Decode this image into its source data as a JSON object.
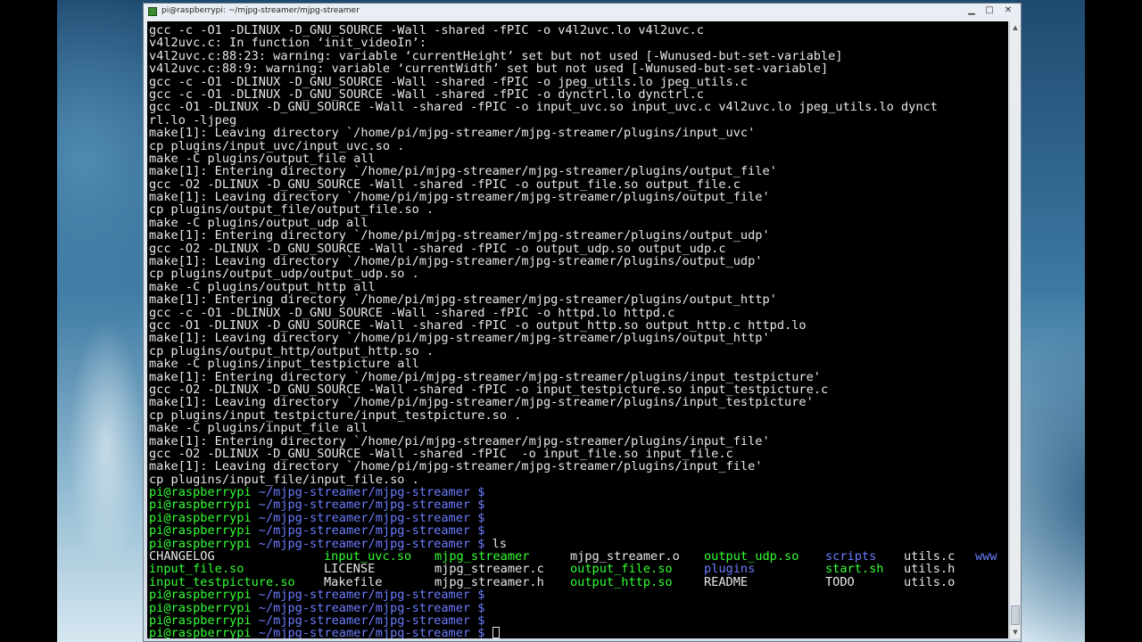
{
  "window": {
    "title": "pi@raspberrypi: ~/mjpg-streamer/mjpg-streamer",
    "buttons": {
      "minimize": "▁",
      "maximize": "□",
      "close": "✕"
    }
  },
  "terminal": {
    "output": [
      "gcc -c -O1 -DLINUX -D_GNU_SOURCE -Wall -shared -fPIC -o v4l2uvc.lo v4l2uvc.c",
      "v4l2uvc.c: In function ‘init_videoIn’:",
      "v4l2uvc.c:88:23: warning: variable ‘currentHeight’ set but not used [-Wunused-but-set-variable]",
      "v4l2uvc.c:88:9: warning: variable ‘currentWidth’ set but not used [-Wunused-but-set-variable]",
      "gcc -c -O1 -DLINUX -D_GNU_SOURCE -Wall -shared -fPIC -o jpeg_utils.lo jpeg_utils.c",
      "gcc -c -O1 -DLINUX -D_GNU_SOURCE -Wall -shared -fPIC -o dynctrl.lo dynctrl.c",
      "gcc -O1 -DLINUX -D_GNU_SOURCE -Wall -shared -fPIC -o input_uvc.so input_uvc.c v4l2uvc.lo jpeg_utils.lo dynct",
      "rl.lo -ljpeg",
      "make[1]: Leaving directory `/home/pi/mjpg-streamer/mjpg-streamer/plugins/input_uvc'",
      "cp plugins/input_uvc/input_uvc.so .",
      "make -C plugins/output_file all",
      "make[1]: Entering directory `/home/pi/mjpg-streamer/mjpg-streamer/plugins/output_file'",
      "gcc -O2 -DLINUX -D_GNU_SOURCE -Wall -shared -fPIC -o output_file.so output_file.c",
      "make[1]: Leaving directory `/home/pi/mjpg-streamer/mjpg-streamer/plugins/output_file'",
      "cp plugins/output_file/output_file.so .",
      "make -C plugins/output_udp all",
      "make[1]: Entering directory `/home/pi/mjpg-streamer/mjpg-streamer/plugins/output_udp'",
      "gcc -O2 -DLINUX -D_GNU_SOURCE -Wall -shared -fPIC -o output_udp.so output_udp.c",
      "make[1]: Leaving directory `/home/pi/mjpg-streamer/mjpg-streamer/plugins/output_udp'",
      "cp plugins/output_udp/output_udp.so .",
      "make -C plugins/output_http all",
      "make[1]: Entering directory `/home/pi/mjpg-streamer/mjpg-streamer/plugins/output_http'",
      "gcc -c -O1 -DLINUX -D_GNU_SOURCE -Wall -shared -fPIC -o httpd.lo httpd.c",
      "gcc -O1 -DLINUX -D_GNU_SOURCE -Wall -shared -fPIC -o output_http.so output_http.c httpd.lo",
      "make[1]: Leaving directory `/home/pi/mjpg-streamer/mjpg-streamer/plugins/output_http'",
      "cp plugins/output_http/output_http.so .",
      "make -C plugins/input_testpicture all",
      "make[1]: Entering directory `/home/pi/mjpg-streamer/mjpg-streamer/plugins/input_testpicture'",
      "gcc -O2 -DLINUX -D_GNU_SOURCE -Wall -shared -fPIC -o input_testpicture.so input_testpicture.c",
      "make[1]: Leaving directory `/home/pi/mjpg-streamer/mjpg-streamer/plugins/input_testpicture'",
      "cp plugins/input_testpicture/input_testpicture.so .",
      "make -C plugins/input_file all",
      "make[1]: Entering directory `/home/pi/mjpg-streamer/mjpg-streamer/plugins/input_file'",
      "gcc -O2 -DLINUX -D_GNU_SOURCE -Wall -shared -fPIC  -o input_file.so input_file.c",
      "make[1]: Leaving directory `/home/pi/mjpg-streamer/mjpg-streamer/plugins/input_file'",
      "cp plugins/input_file/input_file.so ."
    ],
    "prompt_user": "pi@raspberrypi",
    "prompt_path": " ~/mjpg-streamer/mjpg-streamer $",
    "empty_prompts_before": 4,
    "command": " ls",
    "ls_rows": [
      [
        {
          "text": "CHANGELOG",
          "color": "w"
        },
        {
          "text": "input_uvc.so",
          "color": "g"
        },
        {
          "text": "mjpg_streamer",
          "color": "g"
        },
        {
          "text": "mjpg_streamer.o",
          "color": "w"
        },
        {
          "text": "output_udp.so",
          "color": "g"
        },
        {
          "text": "scripts",
          "color": "b"
        },
        {
          "text": "utils.c",
          "color": "w"
        },
        {
          "text": "www",
          "color": "b"
        }
      ],
      [
        {
          "text": "input_file.so",
          "color": "g"
        },
        {
          "text": "LICENSE",
          "color": "w"
        },
        {
          "text": "mjpg_streamer.c",
          "color": "w"
        },
        {
          "text": "output_file.so",
          "color": "g"
        },
        {
          "text": "plugins",
          "color": "b"
        },
        {
          "text": "start.sh",
          "color": "g"
        },
        {
          "text": "utils.h",
          "color": "w"
        }
      ],
      [
        {
          "text": "input_testpicture.so",
          "color": "g"
        },
        {
          "text": "Makefile",
          "color": "w"
        },
        {
          "text": "mjpg_streamer.h",
          "color": "w"
        },
        {
          "text": "output_http.so",
          "color": "g"
        },
        {
          "text": "README",
          "color": "w"
        },
        {
          "text": "TODO",
          "color": "w"
        },
        {
          "text": "utils.o",
          "color": "w"
        }
      ]
    ],
    "empty_prompts_after": 4
  },
  "colors": {
    "prompt_green": "#33ff33",
    "path_blue": "#6c7dff",
    "text": "#e8e8e8",
    "background": "#000000"
  }
}
